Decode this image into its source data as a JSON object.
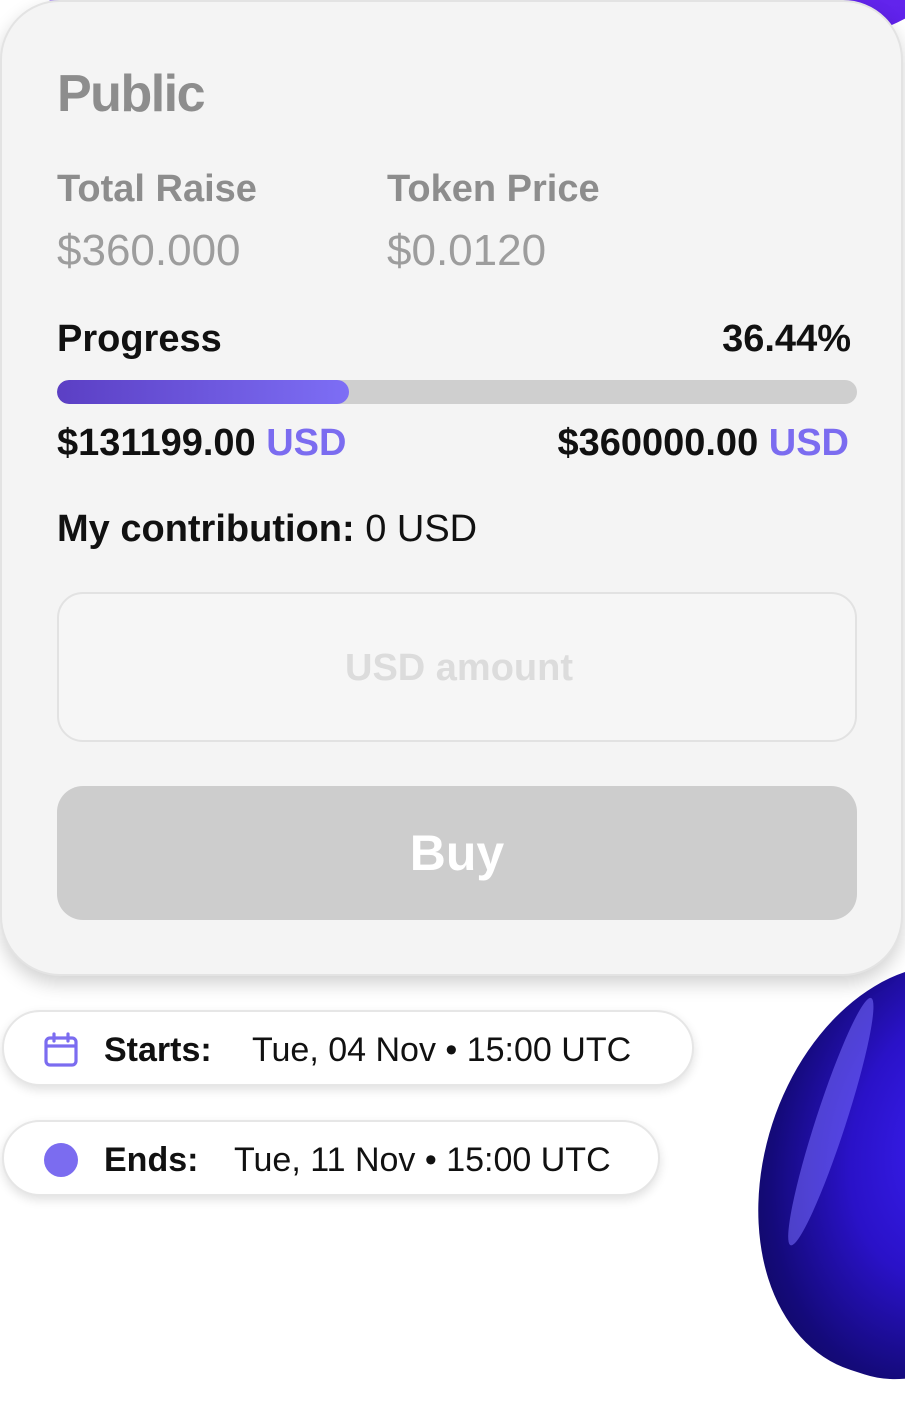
{
  "sale": {
    "title": "Public",
    "total_raise_label": "Total Raise",
    "total_raise_value": "$360.000",
    "token_price_label": "Token Price",
    "token_price_value": "$0.0120"
  },
  "progress": {
    "label": "Progress",
    "percent_text": "36.44%",
    "fraction": 0.3644,
    "raised_amount": "$131199.00",
    "raised_currency": "USD",
    "goal_amount": "$360000.00",
    "goal_currency": "USD"
  },
  "contribution": {
    "label": "My contribution:",
    "value": "0 USD"
  },
  "purchase": {
    "amount_placeholder": "USD amount",
    "buy_label": "Buy"
  },
  "schedule": {
    "starts_label": "Starts:",
    "starts_value": "Tue, 04 Nov • 15:00 UTC",
    "starts_icon": "calendar-icon",
    "ends_label": "Ends:",
    "ends_value": "Tue, 11 Nov • 15:00 UTC",
    "ends_icon": "status-dot-icon"
  },
  "colors": {
    "accent": "#7b6cf0",
    "card_bg": "#f4f4f4",
    "button_disabled": "#cdcdcd"
  }
}
